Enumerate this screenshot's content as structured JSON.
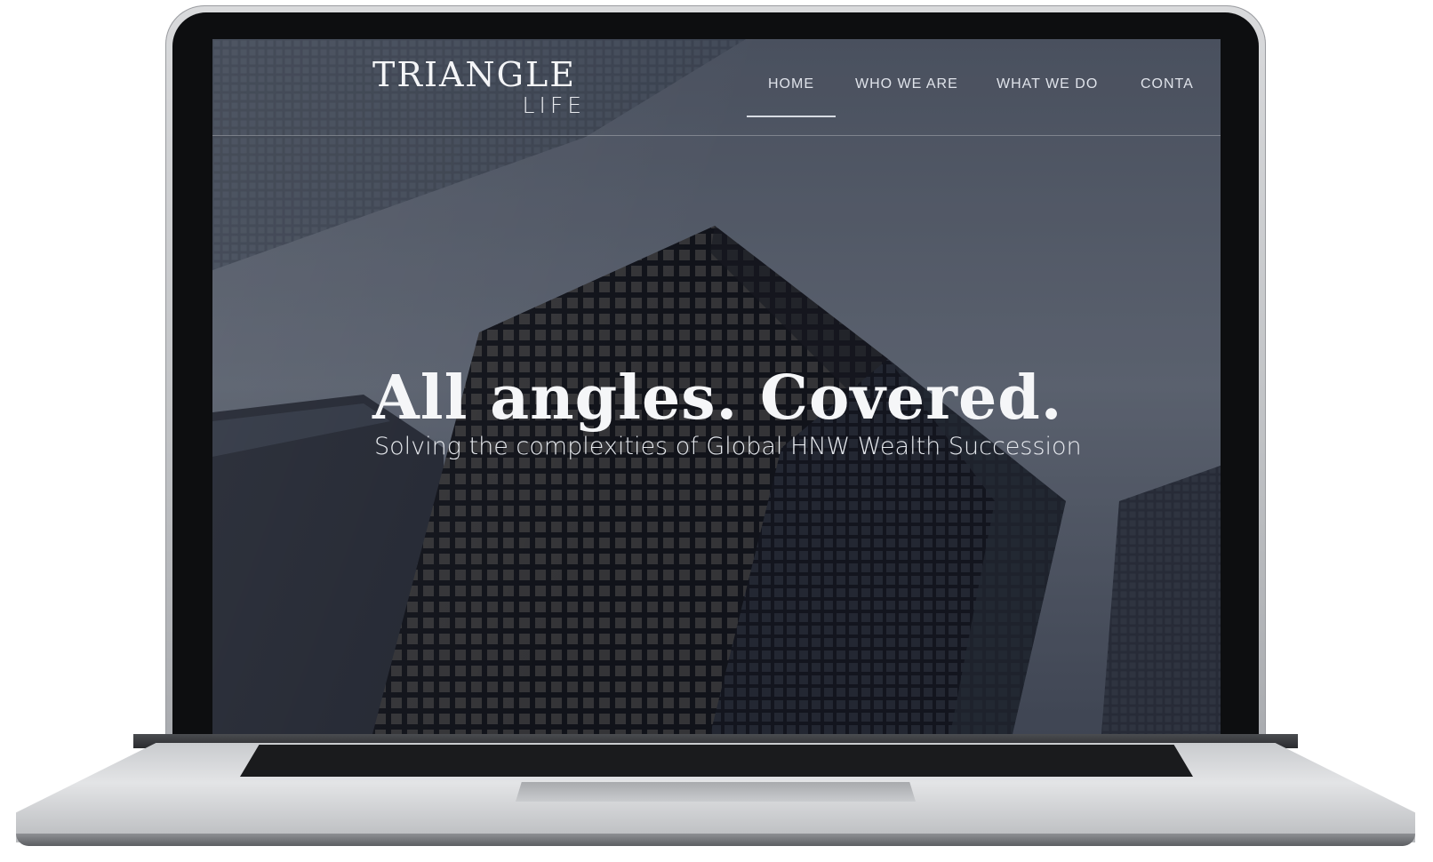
{
  "site": {
    "logo_main": "TRIANGLE",
    "logo_sub": "LIFE",
    "nav": [
      {
        "label": "HOME",
        "active": true
      },
      {
        "label": "WHO WE ARE",
        "active": false
      },
      {
        "label": "WHAT WE DO",
        "active": false
      },
      {
        "label": "CONTA",
        "active": false
      }
    ],
    "headline": "All angles. Covered.",
    "subheadline": "Solving the complexities of Global HNW Wealth Succession"
  },
  "colors": {
    "sky": "#6b7483",
    "building_dark": "#1d2028",
    "text_light": "#f4f5f7"
  },
  "icons": [
    "laptop-icon"
  ]
}
